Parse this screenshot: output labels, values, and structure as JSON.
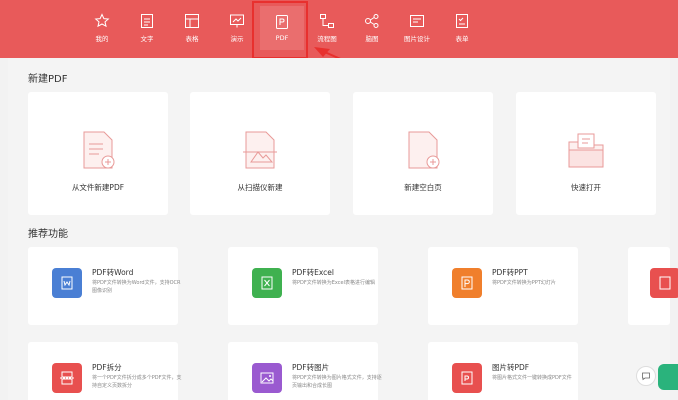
{
  "nav": {
    "items": [
      {
        "label": "我的",
        "icon": "star-icon"
      },
      {
        "label": "文字",
        "icon": "document-icon"
      },
      {
        "label": "表格",
        "icon": "table-icon"
      },
      {
        "label": "演示",
        "icon": "presentation-icon"
      },
      {
        "label": "PDF",
        "icon": "pdf-icon"
      },
      {
        "label": "流程图",
        "icon": "flowchart-icon"
      },
      {
        "label": "脑图",
        "icon": "mindmap-icon"
      },
      {
        "label": "图片设计",
        "icon": "image-design-icon"
      },
      {
        "label": "表单",
        "icon": "form-icon"
      }
    ],
    "active": "PDF"
  },
  "new_pdf": {
    "title": "新建PDF",
    "cards": [
      {
        "label": "从文件新建PDF",
        "icon": "file-add-icon"
      },
      {
        "label": "从扫描仪新建",
        "icon": "scanner-icon"
      },
      {
        "label": "新建空白页",
        "icon": "blank-page-add-icon"
      },
      {
        "label": "快速打开",
        "icon": "folder-pdf-icon"
      }
    ]
  },
  "recommended": {
    "title": "推荐功能",
    "items": [
      {
        "title": "PDF转Word",
        "desc": "将PDF文件转换为Word文件，支持OCR图像识别",
        "color": "#4a7fd4",
        "icon": "word-icon"
      },
      {
        "title": "PDF转Excel",
        "desc": "将PDF文件转换为Excel表格进行编辑",
        "color": "#3fb150",
        "icon": "excel-icon"
      },
      {
        "title": "PDF转PPT",
        "desc": "将PDF文件转换为PPT幻灯片",
        "color": "#f07f2c",
        "icon": "ppt-icon"
      },
      {
        "title": "PDF拆分",
        "desc": "将一个PDF文件拆分成多个PDF文件，支持自定义页数拆分",
        "color": "#e8504f",
        "icon": "split-icon"
      },
      {
        "title": "PDF转图片",
        "desc": "将PDF文件转换为图片格式文件，支持逐页输出和合成长图",
        "color": "#9a5ad0",
        "icon": "image-icon"
      },
      {
        "title": "图片转PDF",
        "desc": "将图片格式文件一键转换成PDF文件",
        "color": "#e8504f",
        "icon": "image-to-pdf-icon"
      }
    ]
  },
  "colors": {
    "topbar": "#e85a5a",
    "highlight": "#e8302e"
  }
}
